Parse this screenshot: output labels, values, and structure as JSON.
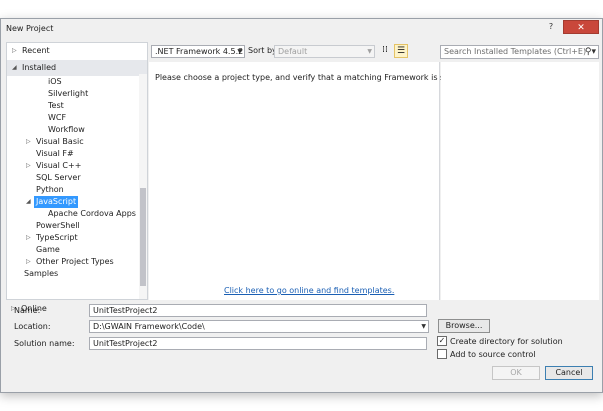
{
  "window": {
    "title": "New Project",
    "close_glyph": "✕",
    "help_glyph": "?"
  },
  "left_nav": {
    "recent": "Recent",
    "installed": "Installed",
    "online": "Online",
    "items": [
      {
        "label": "iOS",
        "indent": 1,
        "arrow": ""
      },
      {
        "label": "Silverlight",
        "indent": 1,
        "arrow": ""
      },
      {
        "label": "Test",
        "indent": 1,
        "arrow": ""
      },
      {
        "label": "WCF",
        "indent": 1,
        "arrow": ""
      },
      {
        "label": "Workflow",
        "indent": 1,
        "arrow": ""
      },
      {
        "label": "Visual Basic",
        "indent": 0,
        "arrow": "▷"
      },
      {
        "label": "Visual F#",
        "indent": 0,
        "arrow": ""
      },
      {
        "label": "Visual C++",
        "indent": 0,
        "arrow": "▷"
      },
      {
        "label": "SQL Server",
        "indent": 0,
        "arrow": ""
      },
      {
        "label": "Python",
        "indent": 0,
        "arrow": ""
      },
      {
        "label": "JavaScript",
        "indent": 0,
        "arrow": "◢",
        "selected": true
      },
      {
        "label": "Apache Cordova Apps",
        "indent": 1,
        "arrow": ""
      },
      {
        "label": "PowerShell",
        "indent": 0,
        "arrow": ""
      },
      {
        "label": "TypeScript",
        "indent": 0,
        "arrow": "▷"
      },
      {
        "label": "Game",
        "indent": 0,
        "arrow": ""
      },
      {
        "label": "Other Project Types",
        "indent": 0,
        "arrow": "▷"
      },
      {
        "label": "Samples",
        "indent": -1,
        "arrow": ""
      }
    ]
  },
  "toolbar": {
    "framework": ".NET Framework 4.5.2",
    "sort_by_label": "Sort by:",
    "sort_by_value": "Default",
    "search_placeholder": "Search Installed Templates (Ctrl+E)"
  },
  "center": {
    "message": "Please choose a project type, and verify that a matching Framework is selected.",
    "online_link": "Click here to go online and find templates."
  },
  "form": {
    "name_label": "Name:",
    "name_value": "UnitTestProject2",
    "location_label": "Location:",
    "location_value": "D:\\GWAIN Framework\\Code\\",
    "solution_label": "Solution name:",
    "solution_value": "UnitTestProject2",
    "browse_label": "Browse...",
    "create_dir_label": "Create directory for solution",
    "create_dir_checked": true,
    "source_control_label": "Add to source control",
    "source_control_checked": false,
    "ok_label": "OK",
    "cancel_label": "Cancel"
  }
}
